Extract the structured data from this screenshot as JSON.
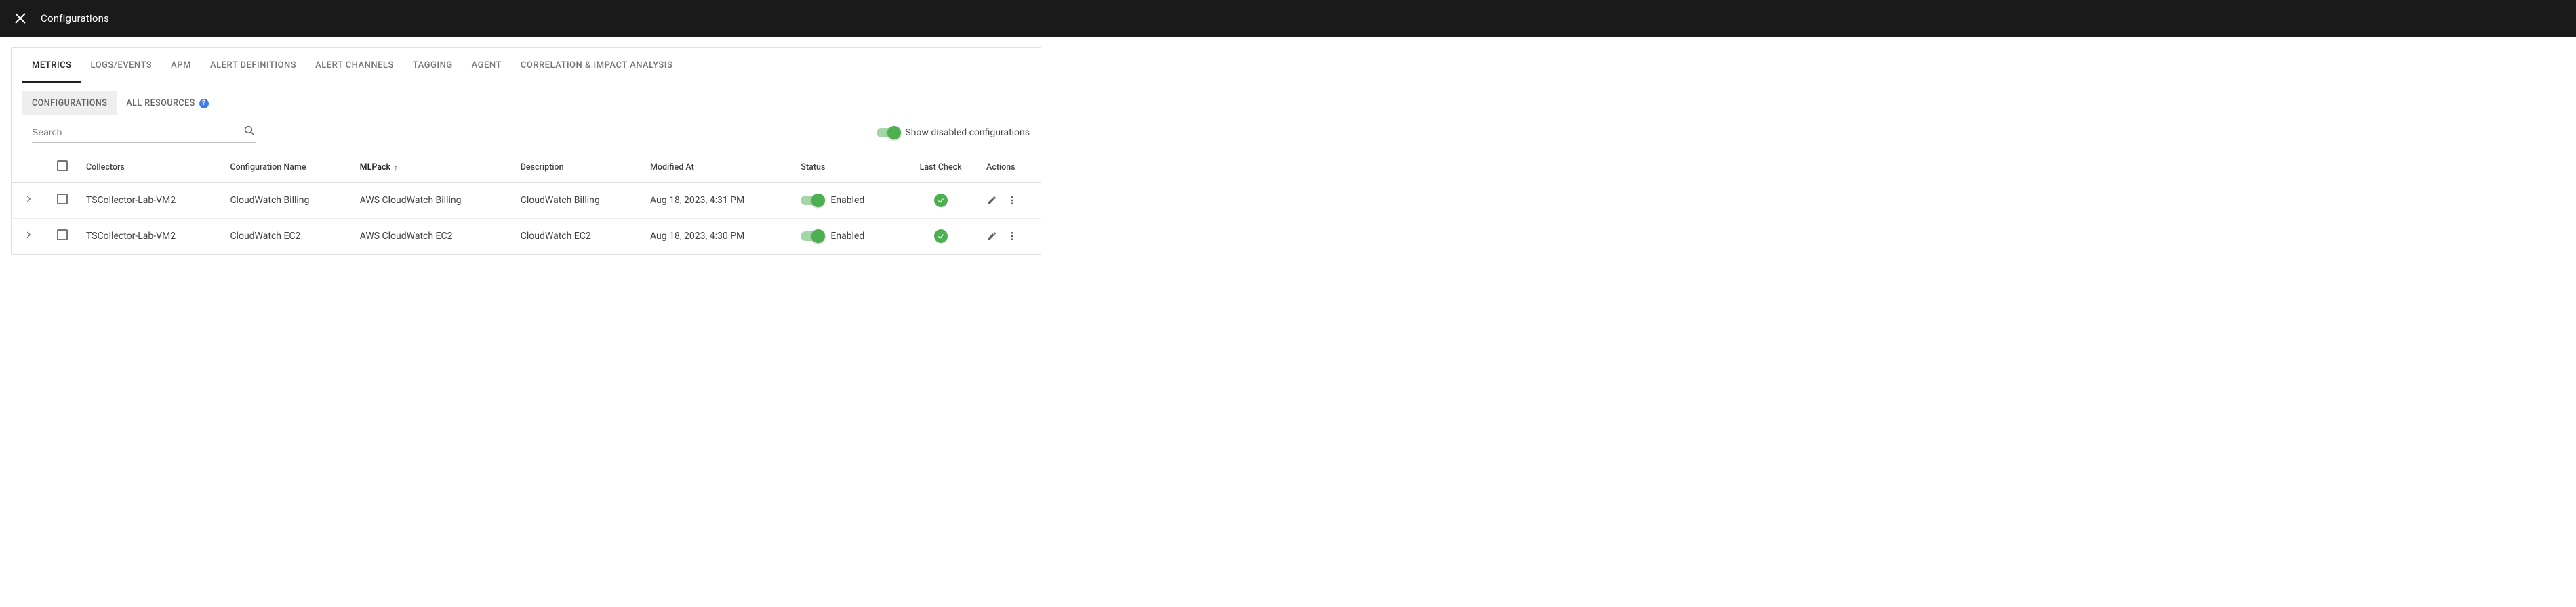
{
  "header": {
    "title": "Configurations"
  },
  "primary_tabs": [
    {
      "label": "METRICS",
      "active": true
    },
    {
      "label": "LOGS/EVENTS"
    },
    {
      "label": "APM"
    },
    {
      "label": "ALERT DEFINITIONS"
    },
    {
      "label": "ALERT CHANNELS"
    },
    {
      "label": "TAGGING"
    },
    {
      "label": "AGENT"
    },
    {
      "label": "CORRELATION & IMPACT ANALYSIS"
    }
  ],
  "sub_tabs": [
    {
      "label": "CONFIGURATIONS",
      "active": true
    },
    {
      "label": "ALL RESOURCES",
      "help": true
    }
  ],
  "search": {
    "placeholder": "Search"
  },
  "toggle": {
    "label": "Show disabled configurations",
    "on": true
  },
  "columns": {
    "collectors": "Collectors",
    "config_name": "Configuration Name",
    "mlpack": "MLPack",
    "description": "Description",
    "modified_at": "Modified At",
    "status": "Status",
    "last_check": "Last Check",
    "actions": "Actions"
  },
  "sort": {
    "column": "mlpack",
    "dir": "asc",
    "arrow": "↑"
  },
  "rows": [
    {
      "collectors": "TSCollector-Lab-VM2",
      "config_name": "CloudWatch Billing",
      "mlpack": "AWS CloudWatch Billing",
      "description": "CloudWatch Billing",
      "modified_at": "Aug 18, 2023, 4:31 PM",
      "status_label": "Enabled",
      "status_on": true,
      "last_check_ok": true
    },
    {
      "collectors": "TSCollector-Lab-VM2",
      "config_name": "CloudWatch EC2",
      "mlpack": "AWS CloudWatch EC2",
      "description": "CloudWatch EC2",
      "modified_at": "Aug 18, 2023, 4:30 PM",
      "status_label": "Enabled",
      "status_on": true,
      "last_check_ok": true
    }
  ]
}
